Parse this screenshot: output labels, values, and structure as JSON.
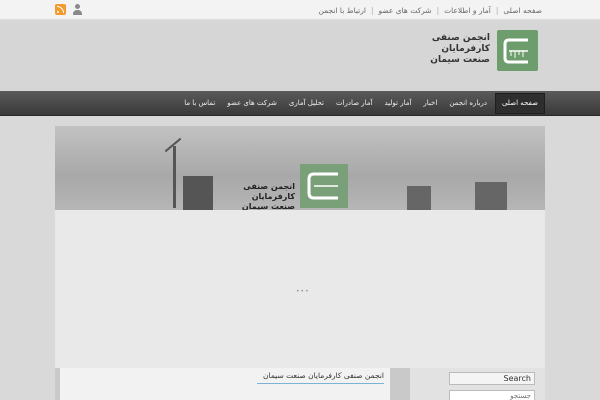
{
  "top_links": [
    "صفحه اصلی",
    "آمار و اطلاعات",
    "شرکت های عضو",
    "ارتباط با انجمن"
  ],
  "logo_text": "انجمن صنفی کارفرمایان صنعت سیمان",
  "nav": [
    "صفحه اصلی",
    "درباره انجمن",
    "اخبار",
    "آمار تولید",
    "آمار صادرات",
    "تحلیل آماری",
    "شرکت های عضو",
    "تماس با ما"
  ],
  "slider_text": "انجمن صنفی کارفرمایان صنعت سیمان",
  "loading": "•••",
  "post_title": "انجمن صنفی کارفرمایان صنعت سیمان",
  "search": {
    "button": "Search",
    "placeholder": "جستجو"
  }
}
